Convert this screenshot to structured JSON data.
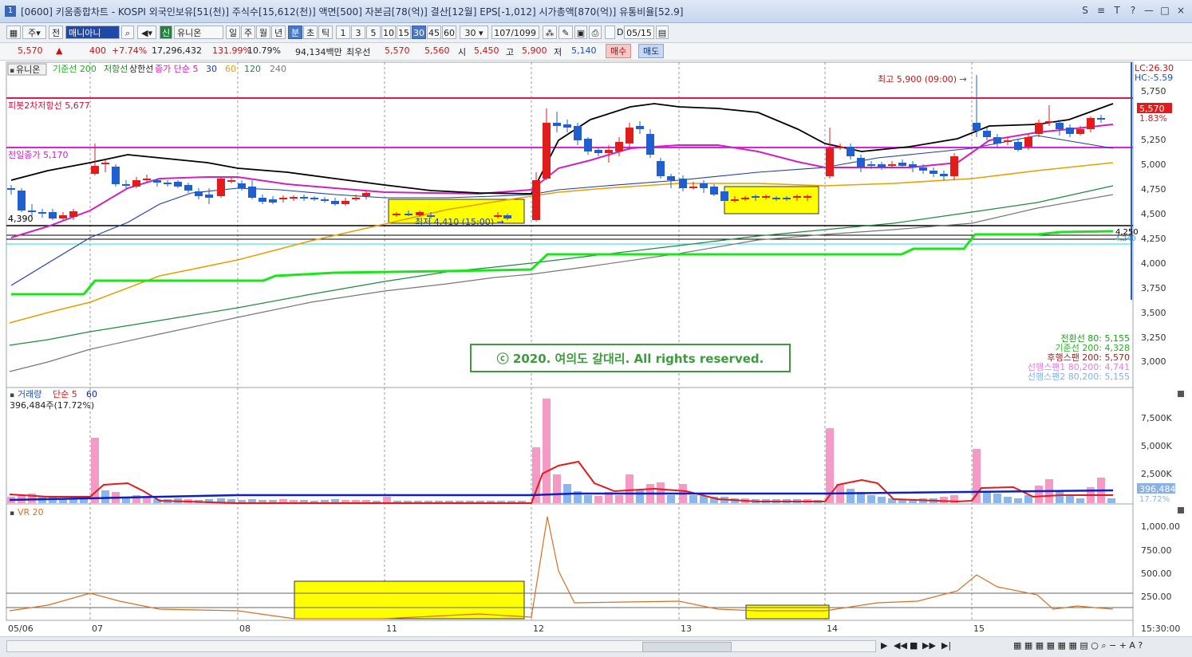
{
  "window": {
    "title": "[0600] 키움종합차트 - KOSPI 외국인보유[51(천)] 주식수[15,612(천)] 액면[500] 자본금[78(억)] 결산[12월] EPS[-1,012] 시가총액[870(억)] 유통비율[52.9]",
    "app_number": "1",
    "controls": [
      "S",
      "≡",
      "T",
      "?",
      "—",
      "□",
      "×"
    ]
  },
  "toolbar": {
    "type_select": "주",
    "jeon": "전",
    "search_value": "매니아니",
    "stock_name": "유니온",
    "stock_prefix": "신",
    "periods": [
      "일",
      "주",
      "월",
      "년",
      "분",
      "초",
      "틱"
    ],
    "active_period": "분",
    "intervals": [
      "1",
      "3",
      "5",
      "10",
      "15",
      "30",
      "45",
      "60"
    ],
    "active_interval": "30",
    "interval_select": "30",
    "count": "107",
    "total": "/1099",
    "d_label": "D",
    "date": "05/15"
  },
  "quote": {
    "price": "5,570",
    "arrow": "▲",
    "change": "400",
    "change_pct": "+7.74%",
    "volume": "17,296,432",
    "vol_ratio": "131.99%",
    "turnover": "10.79%",
    "amount": "94,134백만",
    "pref_label": "최우선",
    "ask": "5,570",
    "bid": "5,560",
    "open_label": "시",
    "open": "5,450",
    "high_label": "고",
    "high": "5,900",
    "low_label": "저",
    "low": "5,140",
    "buy_label": "매수",
    "sell_label": "매도"
  },
  "price_panel": {
    "stock_tab": "유니온",
    "indicators": [
      {
        "text": "기준선 200",
        "color": "#22aa22"
      },
      {
        "text": "저항선",
        "color": "#2d7d2d"
      },
      {
        "text": "상한선",
        "color": "#222222"
      },
      {
        "text": "종가 단순 5",
        "color": "#d020c0"
      },
      {
        "text": "30",
        "color": "#1d3bb0"
      },
      {
        "text": "60",
        "color": "#e6a000"
      },
      {
        "text": "120",
        "color": "#1d8a3e"
      },
      {
        "text": "240",
        "color": "#777777"
      }
    ],
    "pivot_label": "피봇2차저항선 5,677",
    "prev_close_label": "전일종가 5,170",
    "high_note": "최고 5,900 (09:00) →",
    "low_note": "최저 4,410 (15:00) →",
    "left_level": "4,390",
    "lc": "LC:26.30",
    "hc": "HC:-5.59",
    "price_tag": "5,570",
    "pct_tag": "1.83%",
    "level_tag": "4,250",
    "level_tag2": "4,240",
    "ichimoku": [
      {
        "text": "전환선 80: 5,155",
        "color": "#15a315"
      },
      {
        "text": "기준선 200: 4,328",
        "color": "#22b522"
      },
      {
        "text": "후행스팬 200: 5,570",
        "color": "#8a2a2a"
      },
      {
        "text": "선행스팬1 80,200: 4,741",
        "color": "#e07ee0"
      },
      {
        "text": "선행스팬2 80,200: 5,155",
        "color": "#7fb2e6"
      }
    ],
    "watermark": "ⓒ 2020. 여의도 갈대리. All rights reserved.",
    "yaxis": [
      "5,750",
      "5,500",
      "5,250",
      "5,000",
      "4,750",
      "4,500",
      "4,250",
      "4,000",
      "3,750",
      "3,500",
      "3,250",
      "3,000"
    ]
  },
  "volume_panel": {
    "title": "거래량",
    "ma_label": "단순 5",
    "ma2": "60",
    "info": "396,484주(17.72%)",
    "yaxis": [
      "7,500K",
      "5,000K",
      "2,500K"
    ],
    "tag": "396,484",
    "tag2": "17.72%"
  },
  "vr_panel": {
    "title": "VR 20",
    "yaxis": [
      "1,000.00",
      "750.00",
      "500.00",
      "250.00"
    ]
  },
  "xaxis": {
    "labels": [
      "05/06",
      "07",
      "08",
      "11",
      "12",
      "13",
      "14",
      "15"
    ],
    "time": "15:30:00"
  },
  "colors": {
    "up": "#e21b1b",
    "down": "#1f5fd0",
    "highlight": "#ffff00",
    "resistance": "#e0194b",
    "prev_close": "#e01ee0",
    "kijun": "#19e619"
  },
  "chart_data": {
    "type": "candlestick",
    "x": [
      "05/06",
      "07",
      "08",
      "11",
      "12",
      "13",
      "14",
      "15"
    ],
    "ylim": [
      2900,
      5900
    ],
    "high": 5900,
    "low": 4410,
    "prev_close": 5170,
    "pivot_r2": 5677
  }
}
